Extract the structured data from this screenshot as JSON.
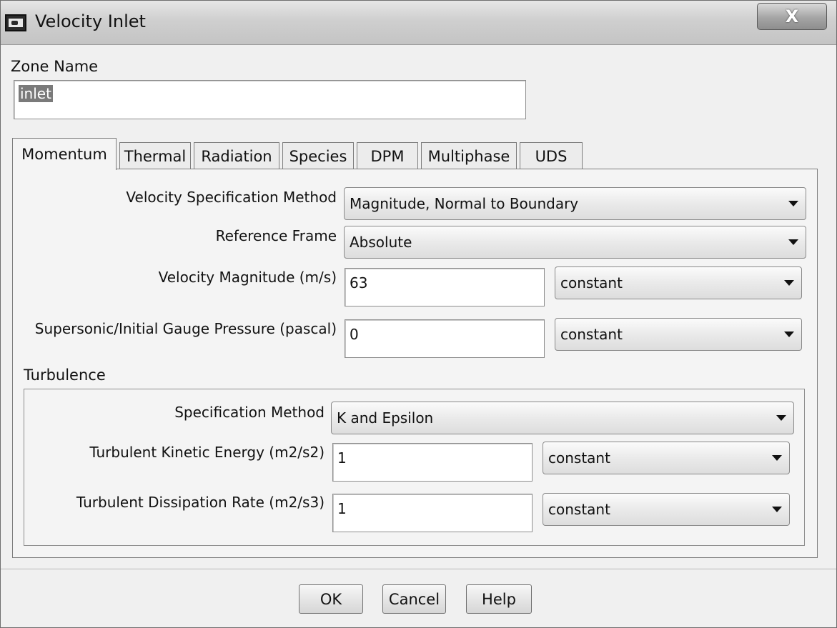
{
  "window": {
    "title": "Velocity Inlet",
    "close_glyph": "X"
  },
  "zone": {
    "label": "Zone Name",
    "value": "inlet"
  },
  "tabs": [
    "Momentum",
    "Thermal",
    "Radiation",
    "Species",
    "DPM",
    "Multiphase",
    "UDS"
  ],
  "active_tab": "Momentum",
  "momentum": {
    "velocity_spec": {
      "label": "Velocity Specification Method",
      "value": "Magnitude, Normal to Boundary"
    },
    "reference_frame": {
      "label": "Reference Frame",
      "value": "Absolute"
    },
    "velocity_magnitude": {
      "label": "Velocity Magnitude (m/s)",
      "value": "63",
      "profile": "constant"
    },
    "gauge_pressure": {
      "label": "Supersonic/Initial Gauge Pressure (pascal)",
      "value": "0",
      "profile": "constant"
    }
  },
  "turbulence": {
    "title": "Turbulence",
    "spec_method": {
      "label": "Specification Method",
      "value": "K and Epsilon"
    },
    "kinetic_energy": {
      "label": "Turbulent Kinetic Energy (m2/s2)",
      "value": "1",
      "profile": "constant"
    },
    "dissipation_rate": {
      "label": "Turbulent Dissipation Rate (m2/s3)",
      "value": "1",
      "profile": "constant"
    }
  },
  "buttons": {
    "ok": "OK",
    "cancel": "Cancel",
    "help": "Help"
  }
}
